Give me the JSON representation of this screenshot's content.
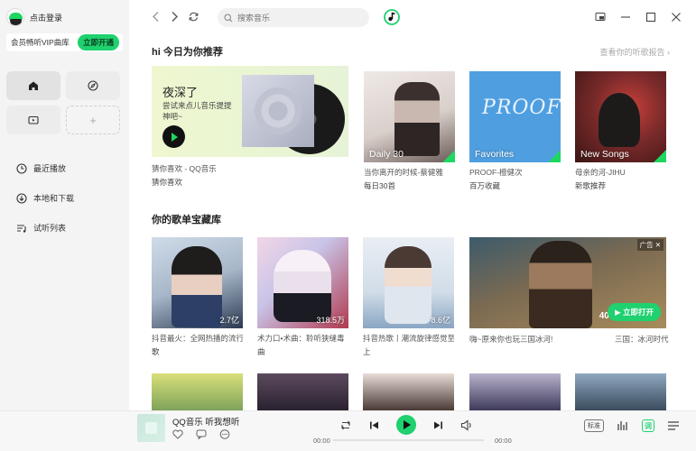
{
  "user": {
    "login_label": "点击登录"
  },
  "vip": {
    "text": "会员畅听VIP曲库",
    "button": "立即开通"
  },
  "sidebar": {
    "tiles": [
      {
        "icon": "home-icon"
      },
      {
        "icon": "compass-icon"
      },
      {
        "icon": "tv-icon"
      },
      {
        "icon": "plus-icon",
        "label": "+"
      }
    ],
    "nav": [
      {
        "label": "最近播放",
        "icon": "clock-icon"
      },
      {
        "label": "本地和下载",
        "icon": "download-icon"
      },
      {
        "label": "试听列表",
        "icon": "playlist-icon"
      }
    ]
  },
  "search": {
    "placeholder": "搜索音乐"
  },
  "recommend": {
    "title": "hi 今日为你推荐",
    "report": "查看你的听歌报告",
    "banner": {
      "title": "夜深了",
      "subtitle": "尝试来点儿音乐提提神吧~",
      "line1": "猜你喜欢 - QQ音乐",
      "line2": "猜你喜欢"
    },
    "cards": [
      {
        "line1": "当你离开的时候-蔡健雅",
        "line2": "每日30首",
        "cover_label": "Daily 30"
      },
      {
        "line1": "PROOF-檀健次",
        "line2": "百万收藏",
        "cover_label": "Favorites"
      },
      {
        "line1": "母亲的河-JIHU",
        "line2": "新歌推荐",
        "cover_label": "New Songs"
      }
    ]
  },
  "library": {
    "title": "你的歌单宝藏库",
    "cards": [
      {
        "line1": "抖音最火：全网热播的流行",
        "line2": "歌",
        "count": "2.7亿"
      },
      {
        "line1": "术力口•术曲：聆听狭缝毒",
        "line2": "曲",
        "count": "318.5万"
      },
      {
        "line1": "抖音热歌丨潮流旋律感觉至",
        "line2": "上",
        "count": "8.6亿"
      }
    ],
    "ad": {
      "badge": "广告 ✕",
      "number": "4000",
      "button": "立即打开",
      "line1": "嗨~原来你也玩三国冰河!",
      "line2": "三国：冰河时代"
    }
  },
  "player": {
    "song": "QQ音乐 听我想听",
    "time_current": "00:00",
    "time_total": "00:00",
    "quality": "标准",
    "lyric": "词"
  },
  "colors": {
    "accent": "#1fd16f"
  }
}
